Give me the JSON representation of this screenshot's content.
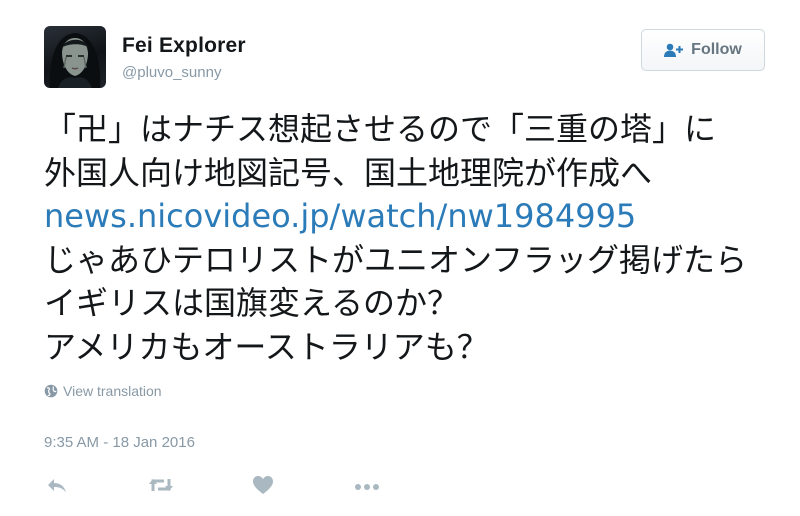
{
  "user": {
    "display_name": "Fei Explorer",
    "handle": "@pluvo_sunny"
  },
  "follow_button": {
    "label": "Follow",
    "icon": "add-user-icon"
  },
  "tweet": {
    "lines": [
      "「卍」はナチス想起させるので「三重の塔」に",
      "外国人向け地図記号、国土地理院が作成へ",
      "news.nicovideo.jp/watch/nw1984995",
      "じゃあひテロリストがユニオンフラッグ掲げたら",
      "イギリスは国旗変えるのか？",
      "アメリカもオーストラリアも？"
    ],
    "link_color": "#2b7bb9"
  },
  "translation": {
    "label": "View translation",
    "icon": "globe-icon"
  },
  "timestamp": "9:35 AM - 18 Jan 2016",
  "actions": [
    {
      "name": "reply",
      "icon": "reply-icon"
    },
    {
      "name": "retweet",
      "icon": "retweet-icon"
    },
    {
      "name": "like",
      "icon": "heart-icon"
    },
    {
      "name": "more",
      "icon": "more-icon"
    }
  ],
  "colors": {
    "text": "#14171a",
    "secondary": "#8899a6",
    "action_icons": "#aab8c2",
    "follow_text": "#66757f"
  }
}
